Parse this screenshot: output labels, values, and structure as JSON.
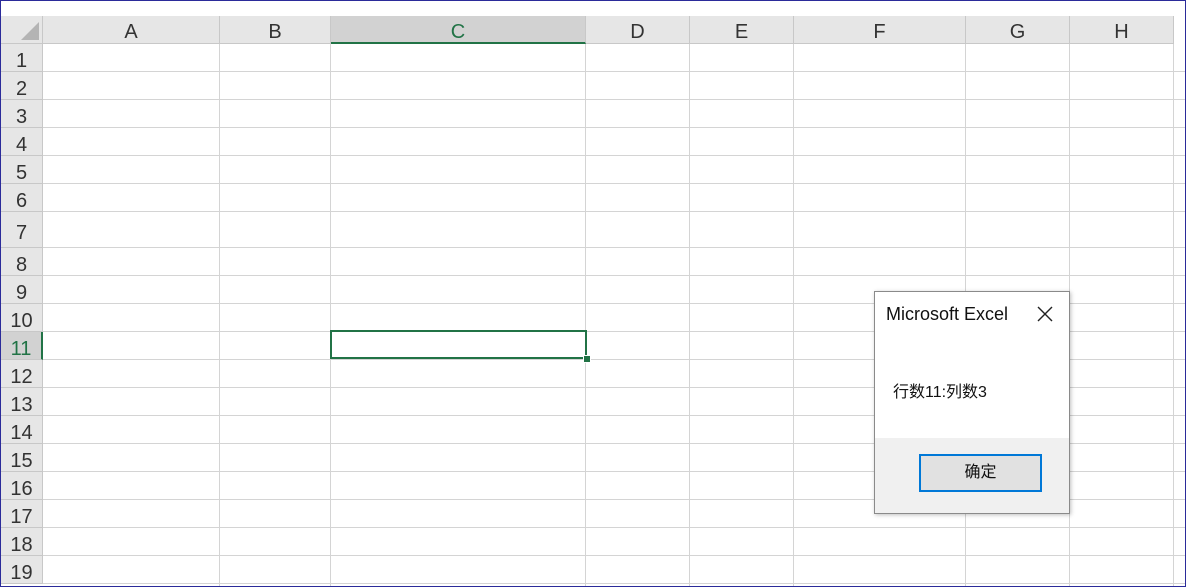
{
  "sheet": {
    "columns": [
      "A",
      "B",
      "C",
      "D",
      "E",
      "F",
      "G",
      "H"
    ],
    "selected_column": "C",
    "rows": [
      "1",
      "2",
      "3",
      "4",
      "5",
      "6",
      "7",
      "8",
      "9",
      "10",
      "11",
      "12",
      "13",
      "14",
      "15",
      "16",
      "17",
      "18",
      "19"
    ],
    "selected_row": "11",
    "grid_color": "#d4d4d4",
    "accent_color": "#217346"
  },
  "dialog": {
    "title": "Microsoft Excel",
    "message": "行数11:列数3",
    "ok_label": "确定",
    "close_icon": "close-icon",
    "button_focus_color": "#0078d7"
  }
}
